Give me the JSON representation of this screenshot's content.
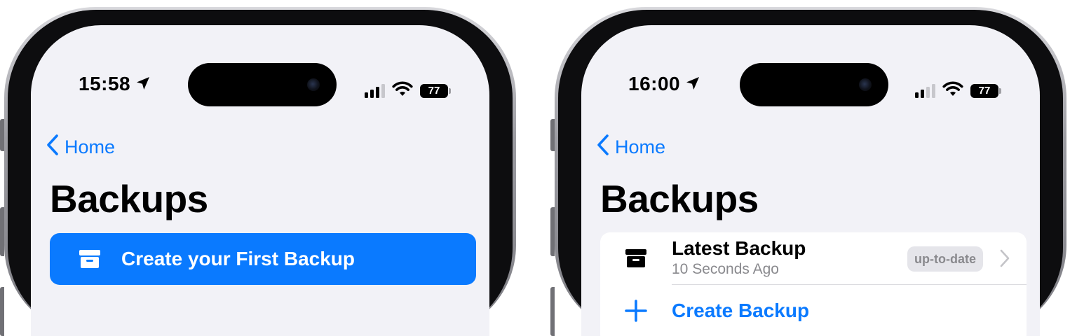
{
  "colors": {
    "accent": "#0a7aff",
    "background": "#f2f2f7",
    "card": "#ffffff",
    "secondary_text": "#8a8a8e",
    "badge_background": "#e5e5ea"
  },
  "left_screen": {
    "status_bar": {
      "time": "15:58",
      "battery": "77"
    },
    "nav": {
      "back_label": "Home"
    },
    "title": "Backups",
    "primary_action": {
      "label": "Create your First Backup",
      "icon": "archive-box-icon"
    }
  },
  "right_screen": {
    "status_bar": {
      "time": "16:00",
      "battery": "77"
    },
    "nav": {
      "back_label": "Home"
    },
    "title": "Backups",
    "latest_backup": {
      "title": "Latest Backup",
      "subtitle": "10 Seconds Ago",
      "badge": "up-to-date",
      "icon": "archive-box-icon"
    },
    "create_backup": {
      "label": "Create Backup",
      "icon": "plus-icon"
    }
  }
}
